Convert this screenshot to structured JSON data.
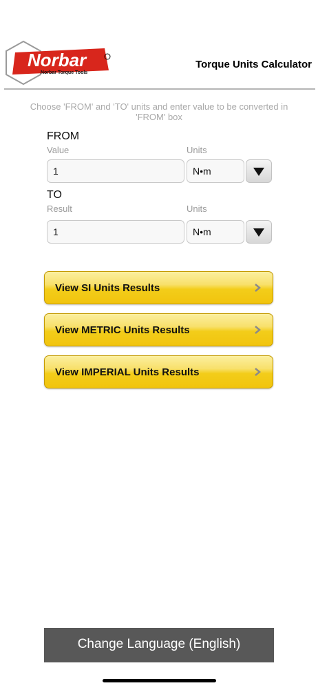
{
  "header": {
    "logo_wordmark": "Norbar",
    "logo_tagline": "Norbar Torque Tools",
    "title": "Torque Units Calculator"
  },
  "instructions": "Choose 'FROM' and 'TO' units and enter value to be converted in 'FROM' box",
  "from": {
    "title": "FROM",
    "value_label": "Value",
    "units_label": "Units",
    "value": "1",
    "unit": "N•m"
  },
  "to": {
    "title": "TO",
    "result_label": "Result",
    "units_label": "Units",
    "result": "1",
    "unit": "N•m"
  },
  "results_buttons": [
    {
      "label": "View SI Units Results"
    },
    {
      "label": "View METRIC Units Results"
    },
    {
      "label": "View IMPERIAL Units Results"
    }
  ],
  "language_button": "Change Language (English)",
  "icons": {
    "dropdown": "triangle-down-icon",
    "chevron": "chevron-right-icon",
    "logo": "norbar-logo"
  },
  "colors": {
    "button_yellow": "#f3cd1a",
    "language_button_bg": "#585858",
    "logo_red": "#d8261c"
  }
}
